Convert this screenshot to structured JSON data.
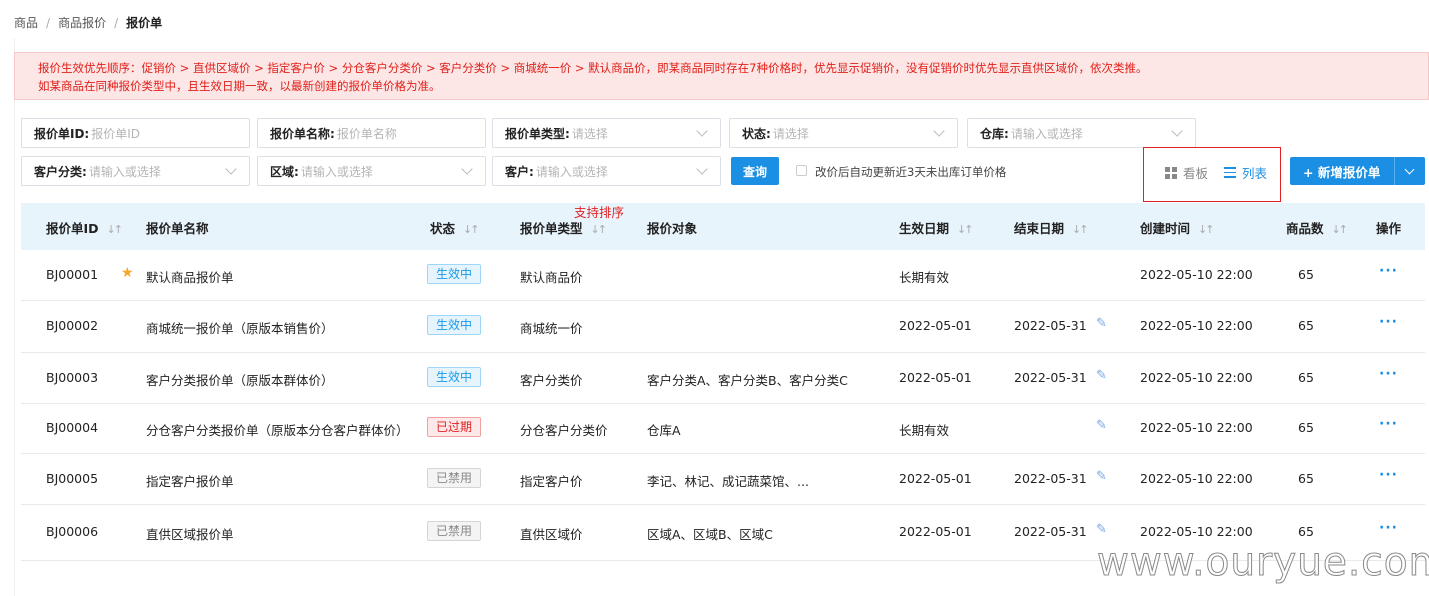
{
  "breadcrumb": [
    "商品",
    "商品报价",
    "报价单"
  ],
  "notice": {
    "line1": "报价生效优先顺序：促销价 > 直供区域价 > 指定客户价 > 分仓客户分类价 > 客户分类价 > 商城统一价 > 默认商品价，即某商品同时存在7种价格时，优先显示促销价，没有促销价时优先显示直供区域价，依次类推。",
    "line2": "如某商品在同种报价类型中，且生效日期一致，以最新创建的报价单价格为准。"
  },
  "filters": {
    "quote_id": {
      "label": "报价单ID:",
      "placeholder": "报价单ID"
    },
    "quote_name": {
      "label": "报价单名称:",
      "placeholder": "报价单名称"
    },
    "quote_type": {
      "label": "报价单类型:",
      "placeholder": "请选择"
    },
    "status": {
      "label": "状态:",
      "placeholder": "请选择"
    },
    "warehouse": {
      "label": "仓库:",
      "placeholder": "请输入或选择"
    },
    "customer_class": {
      "label": "客户分类:",
      "placeholder": "请输入或选择"
    },
    "region": {
      "label": "区域:",
      "placeholder": "请输入或选择"
    },
    "customer": {
      "label": "客户:",
      "placeholder": "请输入或选择"
    }
  },
  "toolbar": {
    "query_label": "查询",
    "auto_update_label": "改价后自动更新近3天未出库订单价格",
    "board_label": "看板",
    "list_label": "列表",
    "add_label": "+ 新增报价单"
  },
  "annotation": "支持排序",
  "table": {
    "headers": {
      "id": "报价单ID",
      "name": "报价单名称",
      "status": "状态",
      "type": "报价单类型",
      "target": "报价对象",
      "start": "生效日期",
      "end": "结束日期",
      "created": "创建时间",
      "count": "商品数",
      "ops": "操作"
    },
    "rows": [
      {
        "id": "BJ00001",
        "name": "默认商品报价单",
        "status": "生效中",
        "status_kind": "active",
        "type": "默认商品价",
        "target": "",
        "start": "长期有效",
        "end": "",
        "created": "2022-05-10 22:00",
        "count": "65",
        "starred": true,
        "editable": false
      },
      {
        "id": "BJ00002",
        "name": "商城统一报价单（原版本销售价）",
        "status": "生效中",
        "status_kind": "active",
        "type": "商城统一价",
        "target": "",
        "start": "2022-05-01",
        "end": "2022-05-31",
        "created": "2022-05-10 22:00",
        "count": "65",
        "starred": false,
        "editable": true
      },
      {
        "id": "BJ00003",
        "name": "客户分类报价单（原版本群体价）",
        "status": "生效中",
        "status_kind": "active",
        "type": "客户分类价",
        "target": "客户分类A、客户分类B、客户分类C",
        "start": "2022-05-01",
        "end": "2022-05-31",
        "created": "2022-05-10 22:00",
        "count": "65",
        "starred": false,
        "editable": true
      },
      {
        "id": "BJ00004",
        "name": "分仓客户分类报价单（原版本分仓客户群体价）",
        "status": "已过期",
        "status_kind": "expired",
        "type": "分仓客户分类价",
        "target": "仓库A",
        "start": "长期有效",
        "end": "",
        "created": "2022-05-10 22:00",
        "count": "65",
        "starred": false,
        "editable": true
      },
      {
        "id": "BJ00005",
        "name": "指定客户报价单",
        "status": "已禁用",
        "status_kind": "disabled",
        "type": "指定客户价",
        "target": "李记、林记、成记蔬菜馆、...",
        "start": "2022-05-01",
        "end": "2022-05-31",
        "created": "2022-05-10 22:00",
        "count": "65",
        "starred": false,
        "editable": true
      },
      {
        "id": "BJ00006",
        "name": "直供区域报价单",
        "status": "已禁用",
        "status_kind": "disabled",
        "type": "直供区域价",
        "target": "区域A、区域B、区域C",
        "start": "2022-05-01",
        "end": "2022-05-31",
        "created": "2022-05-10 22:00",
        "count": "65",
        "starred": false,
        "editable": true
      }
    ]
  },
  "more_symbol": "···",
  "watermark": "www.ouryue.com",
  "colors": {
    "accent": "#1a8fe3",
    "alert": "#e0201a",
    "header_bg": "#e8f4fc"
  }
}
